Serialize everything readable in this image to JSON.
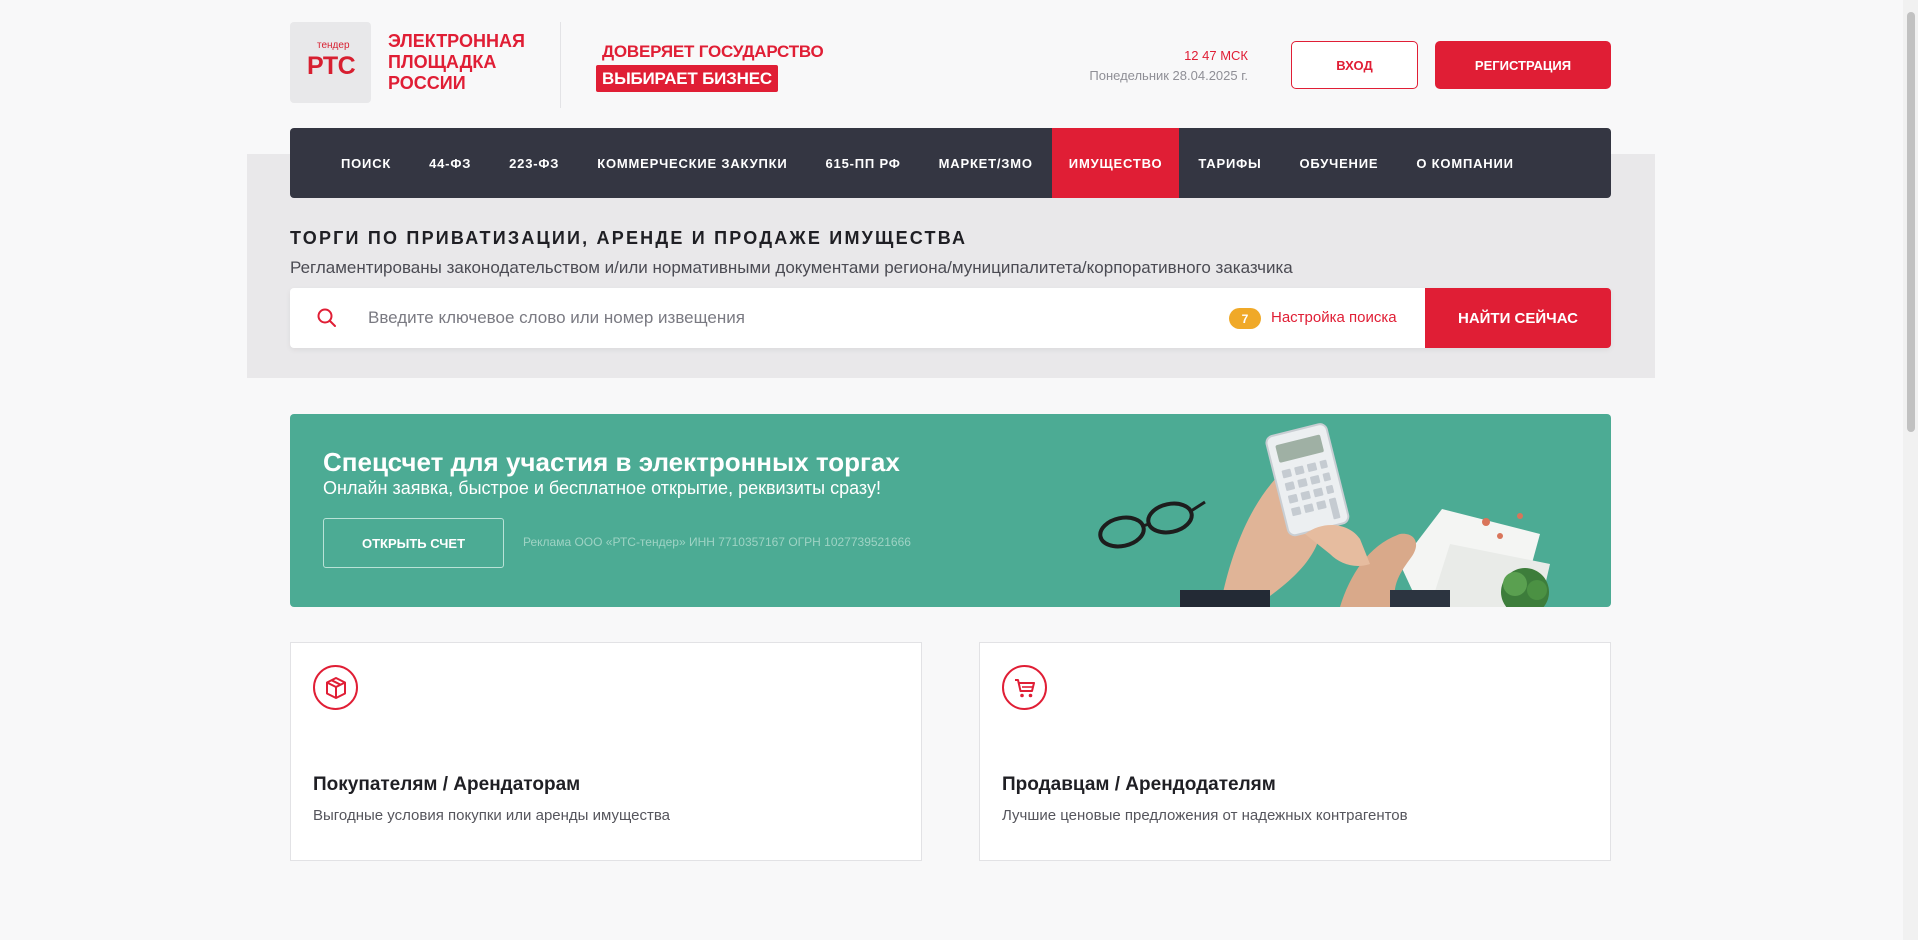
{
  "header": {
    "logo_small": "тендер",
    "logo_big": "РТС",
    "title": "ЭЛЕКТРОННАЯ ПЛОЩАДКА РОССИИ",
    "trust_line": "ДОВЕРЯЕТ ГОСУДАРСТВО",
    "choose_line": "ВЫБИРАЕТ БИЗНЕС",
    "time": "12 47 МСК",
    "date": "Понедельник 28.04.2025 г.",
    "login_label": "ВХОД",
    "register_label": "РЕГИСТРАЦИЯ"
  },
  "nav": {
    "items": [
      {
        "label": "ПОИСК"
      },
      {
        "label": "44-ФЗ"
      },
      {
        "label": "223-ФЗ"
      },
      {
        "label": "КОММЕРЧЕСКИЕ ЗАКУПКИ"
      },
      {
        "label": "615-ПП РФ"
      },
      {
        "label": "МАРКЕТ/ЗМО"
      },
      {
        "label": "ИМУЩЕСТВО"
      },
      {
        "label": "ТАРИФЫ"
      },
      {
        "label": "ОБУЧЕНИЕ"
      },
      {
        "label": "О КОМПАНИИ"
      }
    ],
    "active_index": 6
  },
  "search_section": {
    "title": "ТОРГИ ПО ПРИВАТИЗАЦИИ, АРЕНДЕ И ПРОДАЖЕ ИМУЩЕСТВА",
    "subtitle": "Регламентированы законодательством и/или нормативными документами региона/муниципалитета/корпоративного заказчика",
    "placeholder": "Введите ключевое слово или номер извещения",
    "value": "",
    "settings_count": "7",
    "settings_label": "Настройка поиска",
    "find_label": "НАЙТИ СЕЙЧАС"
  },
  "banner": {
    "title": "Спецсчет для участия в электронных торгах",
    "subtitle": "Онлайн заявка, быстрое и бесплатное открытие, реквизиты сразу!",
    "button_label": "ОТКРЫТЬ СЧЕТ",
    "ad_note": "Реклама ООО «РТС-тендер» ИНН 7710357167 ОГРН 1027739521666"
  },
  "cards": [
    {
      "icon": "box-icon",
      "title": "Покупателям / Арендаторам",
      "text": "Выгодные условия покупки или аренды имущества"
    },
    {
      "icon": "cart-icon",
      "title": "Продавцам / Арендодателям",
      "text": "Лучшие ценовые предложения от надежных контрагентов"
    }
  ],
  "colors": {
    "brand_red": "#e01e35",
    "nav_dark": "#343642",
    "banner_green": "#4cab94",
    "badge_orange": "#f0a928"
  }
}
